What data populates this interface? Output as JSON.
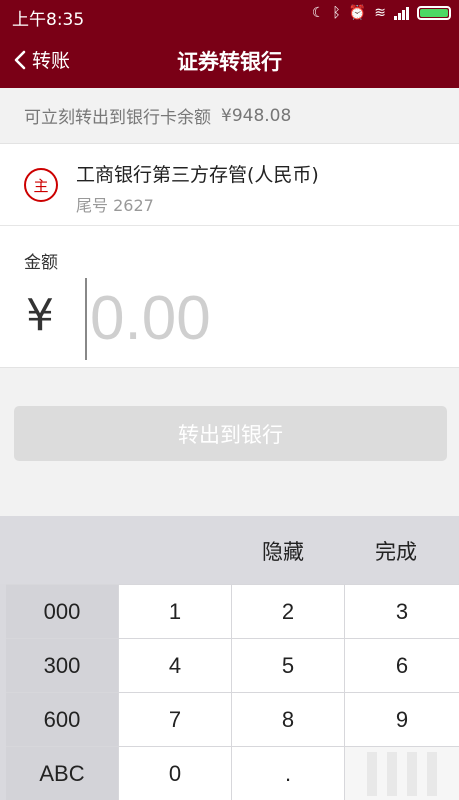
{
  "status": {
    "time": "上午8:35"
  },
  "nav": {
    "back_label": "转账",
    "title": "证券转银行"
  },
  "balance": {
    "label": "可立刻转出到银行卡余额",
    "amount": "¥948.08"
  },
  "bank": {
    "logo_text": "主",
    "name": "工商银行第三方存管(人民币)",
    "tail": "尾号 2627"
  },
  "amount": {
    "label": "金额",
    "currency": "¥",
    "placeholder": "0.00"
  },
  "submit": {
    "label": "转出到银行"
  },
  "keyboard": {
    "hide_label": "隐藏",
    "done_label": "完成",
    "keys": [
      [
        "000",
        "1",
        "2",
        "3"
      ],
      [
        "300",
        "4",
        "5",
        "6"
      ],
      [
        "600",
        "7",
        "8",
        "9"
      ],
      [
        "ABC",
        "0",
        ".",
        ""
      ]
    ]
  },
  "colors": {
    "header": "#7a0016",
    "bank_logo": "#cc0000",
    "battery": "#4cd964"
  }
}
